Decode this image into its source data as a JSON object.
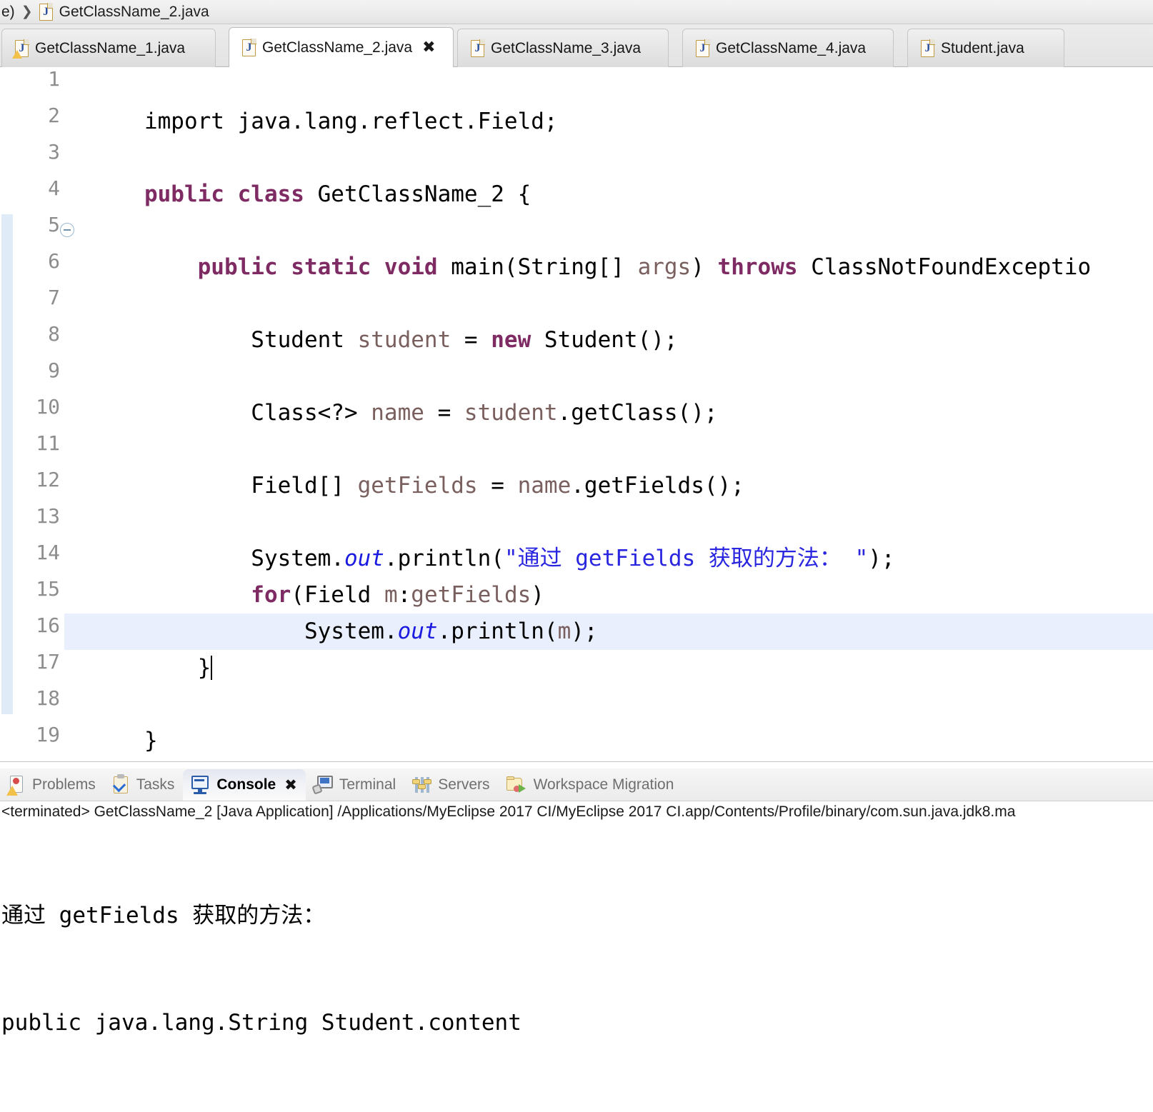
{
  "breadcrumb": {
    "prefix": "e)",
    "separator": "❯",
    "file_icon": "java-file-icon",
    "file": "GetClassName_2.java"
  },
  "editor_tabs": [
    {
      "label": "GetClassName_1.java",
      "icon": "java-file-warning-icon",
      "active": false,
      "has_close": false
    },
    {
      "label": "GetClassName_2.java",
      "icon": "java-file-icon",
      "active": true,
      "has_close": true,
      "close_glyph": "✖"
    },
    {
      "label": "GetClassName_3.java",
      "icon": "java-file-icon",
      "active": false,
      "has_close": false
    },
    {
      "label": "GetClassName_4.java",
      "icon": "java-file-icon",
      "active": false,
      "has_close": false
    },
    {
      "label": "Student.java",
      "icon": "java-file-icon",
      "active": false,
      "has_close": false
    }
  ],
  "editor": {
    "line_numbers": [
      "1",
      "2",
      "3",
      "4",
      "5",
      "6",
      "7",
      "8",
      "9",
      "10",
      "11",
      "12",
      "13",
      "14",
      "15",
      "16",
      "17",
      "18",
      "19"
    ],
    "current_line": 16,
    "fold_marker_line": 5,
    "lines": {
      "l1": "import java.lang.reflect.Field;",
      "l3_kw": "public class",
      "l3_rest": " GetClassName_2 {",
      "l5_indent": "    ",
      "l5_kw1": "public static void",
      "l5_mid": " main(String[] ",
      "l5_var": "args",
      "l5_close": ") ",
      "l5_kw2": "throws",
      "l5_tail": " ClassNotFoundExceptio",
      "l7_pre": "        Student ",
      "l7_var": "student",
      "l7_eq": " = ",
      "l7_kw": "new",
      "l7_tail": " Student();",
      "l9_pre": "        Class<?> ",
      "l9_var": "name",
      "l9_eq": " = ",
      "l9_var2": "student",
      "l9_tail": ".getClass();",
      "l11_pre": "        Field[] ",
      "l11_var": "getFields",
      "l11_eq": " = ",
      "l11_var2": "name",
      "l11_tail": ".getFields();",
      "l13_pre": "        System.",
      "l13_out": "out",
      "l13_mid": ".println(",
      "l13_str": "\"通过 getFields 获取的方法： \"",
      "l13_tail": ");",
      "l14_pre": "        ",
      "l14_kw": "for",
      "l14_mid": "(Field ",
      "l14_var": "m",
      "l14_colon": ":",
      "l14_var2": "getFields",
      "l14_tail": ")",
      "l15_pre": "            System.",
      "l15_out": "out",
      "l15_mid": ".println(",
      "l15_var": "m",
      "l15_tail": ");",
      "l16": "    }",
      "l18": "}"
    }
  },
  "console_tabs": [
    {
      "label": "Problems",
      "icon": "problems-icon",
      "active": false
    },
    {
      "label": "Tasks",
      "icon": "tasks-icon",
      "active": false
    },
    {
      "label": "Console",
      "icon": "console-icon",
      "active": true,
      "close_glyph": "✖"
    },
    {
      "label": "Terminal",
      "icon": "terminal-icon",
      "active": false
    },
    {
      "label": "Servers",
      "icon": "servers-icon",
      "active": false
    },
    {
      "label": "Workspace Migration",
      "icon": "workspace-migration-icon",
      "active": false
    }
  ],
  "console": {
    "launch_line": "<terminated> GetClassName_2 [Java Application] /Applications/MyEclipse 2017 CI/MyEclipse 2017 CI.app/Contents/Profile/binary/com.sun.java.jdk8.ma",
    "output_line_1": "通过 getFields 获取的方法：",
    "output_line_2": "public java.lang.String Student.content"
  },
  "colors": {
    "keyword": "#7f2b63",
    "local_variable": "#7a5f5f",
    "string_literal": "#2a26e0",
    "static_field": "#1a1ae0",
    "current_line_highlight": "#e8eefb",
    "line_number": "#8d8d8d"
  }
}
